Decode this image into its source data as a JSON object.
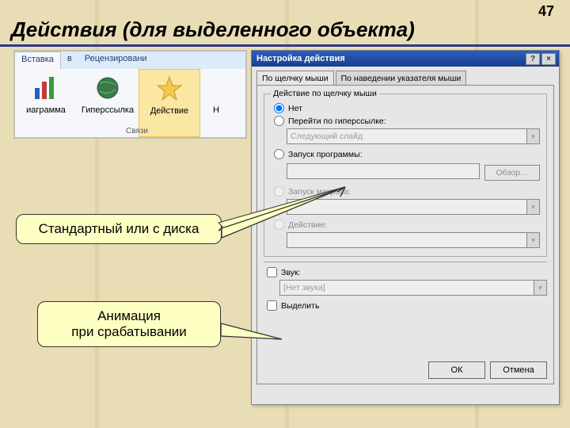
{
  "page_number": "47",
  "slide_title": "Действия (для выделенного объекта)",
  "ribbon": {
    "tabs": [
      "Вставка",
      "в",
      "Рецензировани"
    ],
    "items": [
      {
        "label": "иаграмма",
        "icon": "chart-icon"
      },
      {
        "label": "Гиперссылка",
        "icon": "globe-icon"
      },
      {
        "label": "Действие",
        "icon": "star-icon"
      },
      {
        "label": "Н",
        "icon": ""
      }
    ],
    "group_label": "Связи"
  },
  "dialog": {
    "title": "Настройка действия",
    "help_glyph": "?",
    "close_glyph": "×",
    "tabs": [
      "По щелчку мыши",
      "По наведении указателя мыши"
    ],
    "group_legend": "Действие по щелчку мыши",
    "radio_none": "Нет",
    "radio_hyperlink": "Перейти по гиперссылке:",
    "hyperlink_combo": "Следующий слайд",
    "radio_program": "Запуск программы:",
    "browse_btn": "Обзор…",
    "radio_macro": "Запуск макроса:",
    "radio_action": "Действие:",
    "check_sound": "Звук:",
    "sound_combo": "[Нет звука]",
    "check_highlight": "Выделить",
    "ok": "ОК",
    "cancel": "Отмена"
  },
  "callouts": {
    "c1": "Стандартный или с диска",
    "c2_line1": "Анимация",
    "c2_line2": "при срабатывании"
  },
  "colors": {
    "accent": "#2b3a8a",
    "callout_bg": "#feffc3"
  }
}
